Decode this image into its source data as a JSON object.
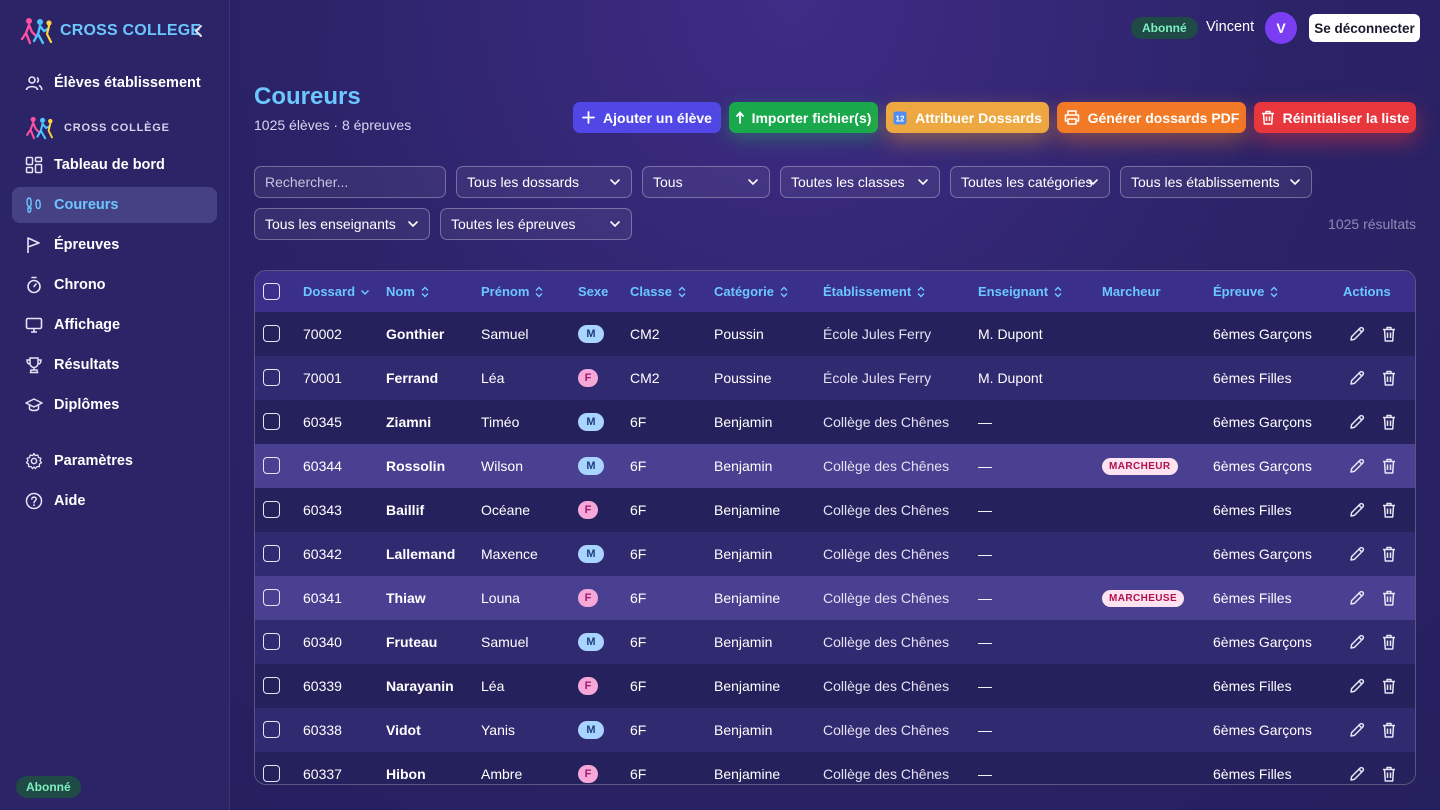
{
  "brand": {
    "name": "CROSS COLLEGE"
  },
  "sidebar": {
    "top_item": {
      "label": "Élèves établissement",
      "icon": "users-icon"
    },
    "section_title": "CROSS COLLÈGE",
    "items": [
      {
        "label": "Tableau de bord",
        "icon": "dashboard-icon"
      },
      {
        "label": "Coureurs",
        "icon": "footprints-icon",
        "active": true
      },
      {
        "label": "Épreuves",
        "icon": "flag-icon"
      },
      {
        "label": "Chrono",
        "icon": "stopwatch-icon"
      },
      {
        "label": "Affichage",
        "icon": "monitor-icon"
      },
      {
        "label": "Résultats",
        "icon": "trophy-icon"
      },
      {
        "label": "Diplômes",
        "icon": "graduation-cap-icon"
      }
    ],
    "bottom_items": [
      {
        "label": "Paramètres",
        "icon": "gear-icon"
      },
      {
        "label": "Aide",
        "icon": "help-icon"
      }
    ],
    "badge": "Abonné"
  },
  "topbar": {
    "badge": "Abonné",
    "user": "Vincent",
    "avatar": "V",
    "logout": "Se déconnecter"
  },
  "page": {
    "title": "Coureurs",
    "subtitle": "1025 élèves · 8 épreuves"
  },
  "actions": {
    "add": "Ajouter un élève",
    "import": "Importer fichier(s)",
    "dossards": "Attribuer Dossards",
    "pdf": "Générer dossards PDF",
    "reset": "Réinitialiser la liste"
  },
  "filters": {
    "search_placeholder": "Rechercher...",
    "dossards": "Tous les dossards",
    "tous": "Tous",
    "classes": "Toutes les classes",
    "categories": "Toutes les catégories",
    "etablissements": "Tous les établissements",
    "enseignants": "Tous les enseignants",
    "epreuves": "Toutes les épreuves",
    "results": "1025 résultats"
  },
  "table": {
    "headers": {
      "dossard": "Dossard",
      "nom": "Nom",
      "prenom": "Prénom",
      "sexe": "Sexe",
      "classe": "Classe",
      "categorie": "Catégorie",
      "etablissement": "Établissement",
      "enseignant": "Enseignant",
      "marcheur": "Marcheur",
      "epreuve": "Épreuve",
      "actions": "Actions"
    },
    "rows": [
      {
        "dossard": "70002",
        "nom": "Gonthier",
        "prenom": "Samuel",
        "sexe": "M",
        "classe": "CM2",
        "categorie": "Poussin",
        "etab": "École Jules Ferry",
        "ens": "M. Dupont",
        "marcheur": "",
        "epreuve": "6èmes Garçons"
      },
      {
        "dossard": "70001",
        "nom": "Ferrand",
        "prenom": "Léa",
        "sexe": "F",
        "classe": "CM2",
        "categorie": "Poussine",
        "etab": "École Jules Ferry",
        "ens": "M. Dupont",
        "marcheur": "",
        "epreuve": "6èmes Filles"
      },
      {
        "dossard": "60345",
        "nom": "Ziamni",
        "prenom": "Timéo",
        "sexe": "M",
        "classe": "6F",
        "categorie": "Benjamin",
        "etab": "Collège des Chênes",
        "ens": "—",
        "marcheur": "",
        "epreuve": "6èmes Garçons"
      },
      {
        "dossard": "60344",
        "nom": "Rossolin",
        "prenom": "Wilson",
        "sexe": "M",
        "classe": "6F",
        "categorie": "Benjamin",
        "etab": "Collège des Chênes",
        "ens": "—",
        "marcheur": "MARCHEUR",
        "epreuve": "6èmes Garçons"
      },
      {
        "dossard": "60343",
        "nom": "Baillif",
        "prenom": "Océane",
        "sexe": "F",
        "classe": "6F",
        "categorie": "Benjamine",
        "etab": "Collège des Chênes",
        "ens": "—",
        "marcheur": "",
        "epreuve": "6èmes Filles"
      },
      {
        "dossard": "60342",
        "nom": "Lallemand",
        "prenom": "Maxence",
        "sexe": "M",
        "classe": "6F",
        "categorie": "Benjamin",
        "etab": "Collège des Chênes",
        "ens": "—",
        "marcheur": "",
        "epreuve": "6èmes Garçons"
      },
      {
        "dossard": "60341",
        "nom": "Thiaw",
        "prenom": "Louna",
        "sexe": "F",
        "classe": "6F",
        "categorie": "Benjamine",
        "etab": "Collège des Chênes",
        "ens": "—",
        "marcheur": "MARCHEUSE",
        "epreuve": "6èmes Filles"
      },
      {
        "dossard": "60340",
        "nom": "Fruteau",
        "prenom": "Samuel",
        "sexe": "M",
        "classe": "6F",
        "categorie": "Benjamin",
        "etab": "Collège des Chênes",
        "ens": "—",
        "marcheur": "",
        "epreuve": "6èmes Garçons"
      },
      {
        "dossard": "60339",
        "nom": "Narayanin",
        "prenom": "Léa",
        "sexe": "F",
        "classe": "6F",
        "categorie": "Benjamine",
        "etab": "Collège des Chênes",
        "ens": "—",
        "marcheur": "",
        "epreuve": "6èmes Filles"
      },
      {
        "dossard": "60338",
        "nom": "Vidot",
        "prenom": "Yanis",
        "sexe": "M",
        "classe": "6F",
        "categorie": "Benjamin",
        "etab": "Collège des Chênes",
        "ens": "—",
        "marcheur": "",
        "epreuve": "6èmes Garçons"
      },
      {
        "dossard": "60337",
        "nom": "Hibon",
        "prenom": "Ambre",
        "sexe": "F",
        "classe": "6F",
        "categorie": "Benjamine",
        "etab": "Collège des Chênes",
        "ens": "—",
        "marcheur": "",
        "epreuve": "6èmes Filles"
      }
    ]
  },
  "colors": {
    "accent": "#6cc7ff",
    "primary": "#5147e6",
    "success": "#19a84b",
    "warning": "#eea842",
    "orange": "#f27a27",
    "danger": "#e8363d"
  }
}
